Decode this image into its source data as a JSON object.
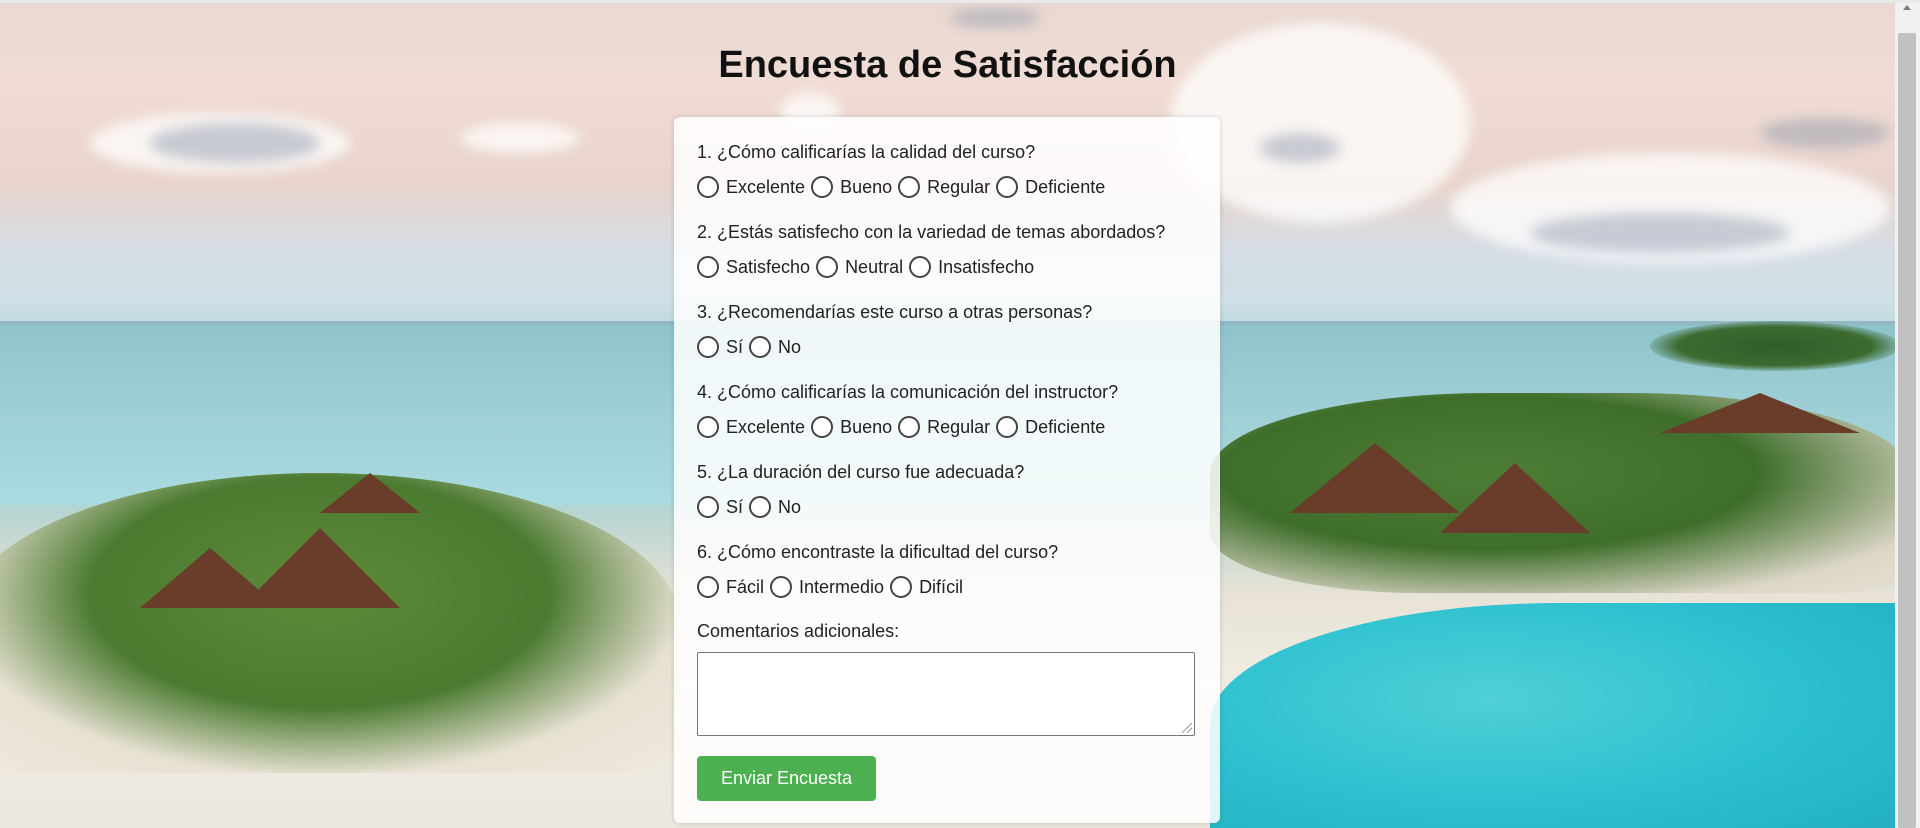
{
  "page": {
    "title": "Encuesta de Satisfacción"
  },
  "survey": {
    "questions": [
      {
        "text": "1. ¿Cómo calificarías la calidad del curso?",
        "options": [
          "Excelente",
          "Bueno",
          "Regular",
          "Deficiente"
        ]
      },
      {
        "text": "2. ¿Estás satisfecho con la variedad de temas abordados?",
        "options": [
          "Satisfecho",
          "Neutral",
          "Insatisfecho"
        ]
      },
      {
        "text": "3. ¿Recomendarías este curso a otras personas?",
        "options": [
          "Sí",
          "No"
        ]
      },
      {
        "text": "4. ¿Cómo calificarías la comunicación del instructor?",
        "options": [
          "Excelente",
          "Bueno",
          "Regular",
          "Deficiente"
        ]
      },
      {
        "text": "5. ¿La duración del curso fue adecuada?",
        "options": [
          "Sí",
          "No"
        ]
      },
      {
        "text": "6. ¿Cómo encontraste la dificultad del curso?",
        "options": [
          "Fácil",
          "Intermedio",
          "Difícil"
        ]
      }
    ],
    "comments_label": "Comentarios adicionales:",
    "comments_value": "",
    "submit_label": "Enviar Encuesta"
  },
  "colors": {
    "submit_button": "#4caf50"
  }
}
